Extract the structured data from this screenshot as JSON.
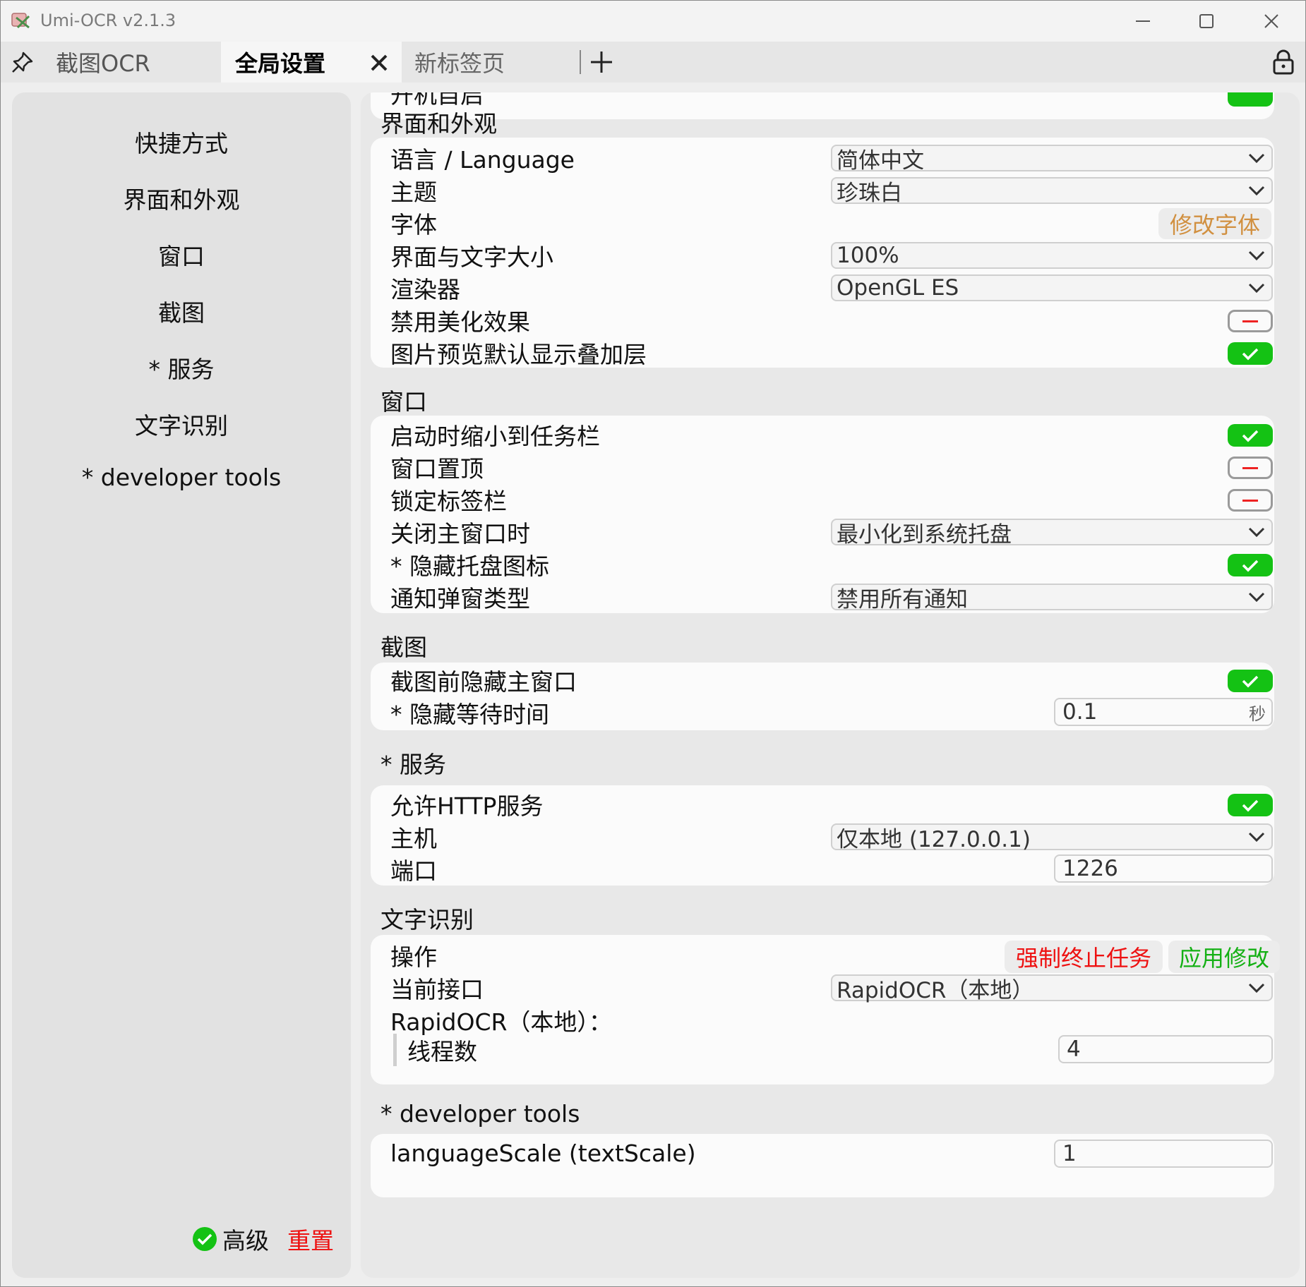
{
  "window": {
    "title": "Umi-OCR v2.1.3"
  },
  "tabs": [
    {
      "label": "截图OCR"
    },
    {
      "label": "全局设置"
    },
    {
      "label": "新标签页"
    }
  ],
  "sidebar": {
    "items": [
      {
        "label": "快捷方式"
      },
      {
        "label": "界面和外观"
      },
      {
        "label": "窗口"
      },
      {
        "label": "截图"
      },
      {
        "label": "* 服务"
      },
      {
        "label": "文字识别"
      },
      {
        "label": "* developer tools"
      }
    ],
    "advanced_label": "高级",
    "advanced_checked": true,
    "reset_label": "重置"
  },
  "settings": {
    "autostart_partial": "开机自启",
    "appearance": {
      "title": "界面和外观",
      "language_label": "语言 / Language",
      "language_value": "简体中文",
      "theme_label": "主题",
      "theme_value": "珍珠白",
      "font_label": "字体",
      "font_button": "修改字体",
      "scale_label": "界面与文字大小",
      "scale_value": "100%",
      "renderer_label": "渲染器",
      "renderer_value": "OpenGL ES",
      "disable_effects_label": "禁用美化效果",
      "overlay_label": "图片预览默认显示叠加层"
    },
    "window": {
      "title": "窗口",
      "minimize_on_start_label": "启动时缩小到任务栏",
      "topmost_label": "窗口置顶",
      "lock_tabs_label": "锁定标签栏",
      "on_close_label": "关闭主窗口时",
      "on_close_value": "最小化到系统托盘",
      "hide_tray_label": "* 隐藏托盘图标",
      "notify_label": "通知弹窗类型",
      "notify_value": "禁用所有通知"
    },
    "screenshot": {
      "title": "截图",
      "hide_main_label": "截图前隐藏主窗口",
      "hide_wait_label": "* 隐藏等待时间",
      "hide_wait_value": "0.1",
      "hide_wait_unit": "秒"
    },
    "service": {
      "title": "* 服务",
      "http_label": "允许HTTP服务",
      "host_label": "主机",
      "host_value": "仅本地 (127.0.0.1)",
      "port_label": "端口",
      "port_value": "1226"
    },
    "ocr": {
      "title": "文字识别",
      "ops_label": "操作",
      "stop_button": "强制终止任务",
      "apply_button": "应用修改",
      "api_label": "当前接口",
      "api_value": "RapidOCR（本地）",
      "engine_label": "RapidOCR（本地）：",
      "threads_label": "线程数",
      "threads_value": "4"
    },
    "dev": {
      "title": "* developer tools",
      "scale_label": "languageScale (textScale)",
      "scale_value": "1"
    }
  },
  "colors": {
    "toggle_on": "#14c214",
    "danger": "#e11111",
    "font_button": "#d19040"
  }
}
